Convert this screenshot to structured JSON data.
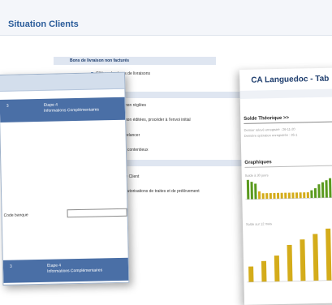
{
  "header": {
    "title": "Situation Clients"
  },
  "menu": {
    "section_title": "Bons de livraison non facturés",
    "items": [
      "Clôturer les bons de livraisons",
      "s non réglées",
      "s non éditées, procéder à l'envoi initial",
      "à relancer",
      "en contentieux",
      "ure Client",
      "s autorisations de traites et de prélèvement"
    ]
  },
  "left_window": {
    "step_top_num": "3",
    "step_top_title": "Etape 4",
    "step_top_sub": "Informations Complémentaires",
    "code_label": "Code banque",
    "step_bottom_num": "3",
    "step_bottom_title": "Etape 4",
    "step_bottom_sub": "Informations Complémentaires"
  },
  "right_window": {
    "title": "CA Languedoc - Tab",
    "solde_label": "Solde Théorique >>",
    "solde_line1": "Dernier relevé enregistré : 26-11-20",
    "solde_line2": "Dernière opération enregistrée : 26-1",
    "graphs_title": "Graphiques",
    "graph1_label": "Solde à 30 jours",
    "graph2_label": "Solde sur 12 mois"
  },
  "chart_data": [
    {
      "type": "bar",
      "title": "Solde à 30 jours",
      "values": [
        10,
        9,
        8,
        4,
        3,
        3,
        3,
        3,
        3,
        3,
        3,
        3,
        3,
        3,
        3,
        3,
        3,
        4,
        5,
        7,
        8,
        9,
        10
      ],
      "colors": [
        "#5a9a1e",
        "#d4ac1a"
      ]
    },
    {
      "type": "bar",
      "title": "Solde sur 12 mois",
      "values": [
        3,
        4,
        5,
        7,
        8,
        9,
        10
      ],
      "colors": [
        "#d4ac1a"
      ]
    }
  ]
}
